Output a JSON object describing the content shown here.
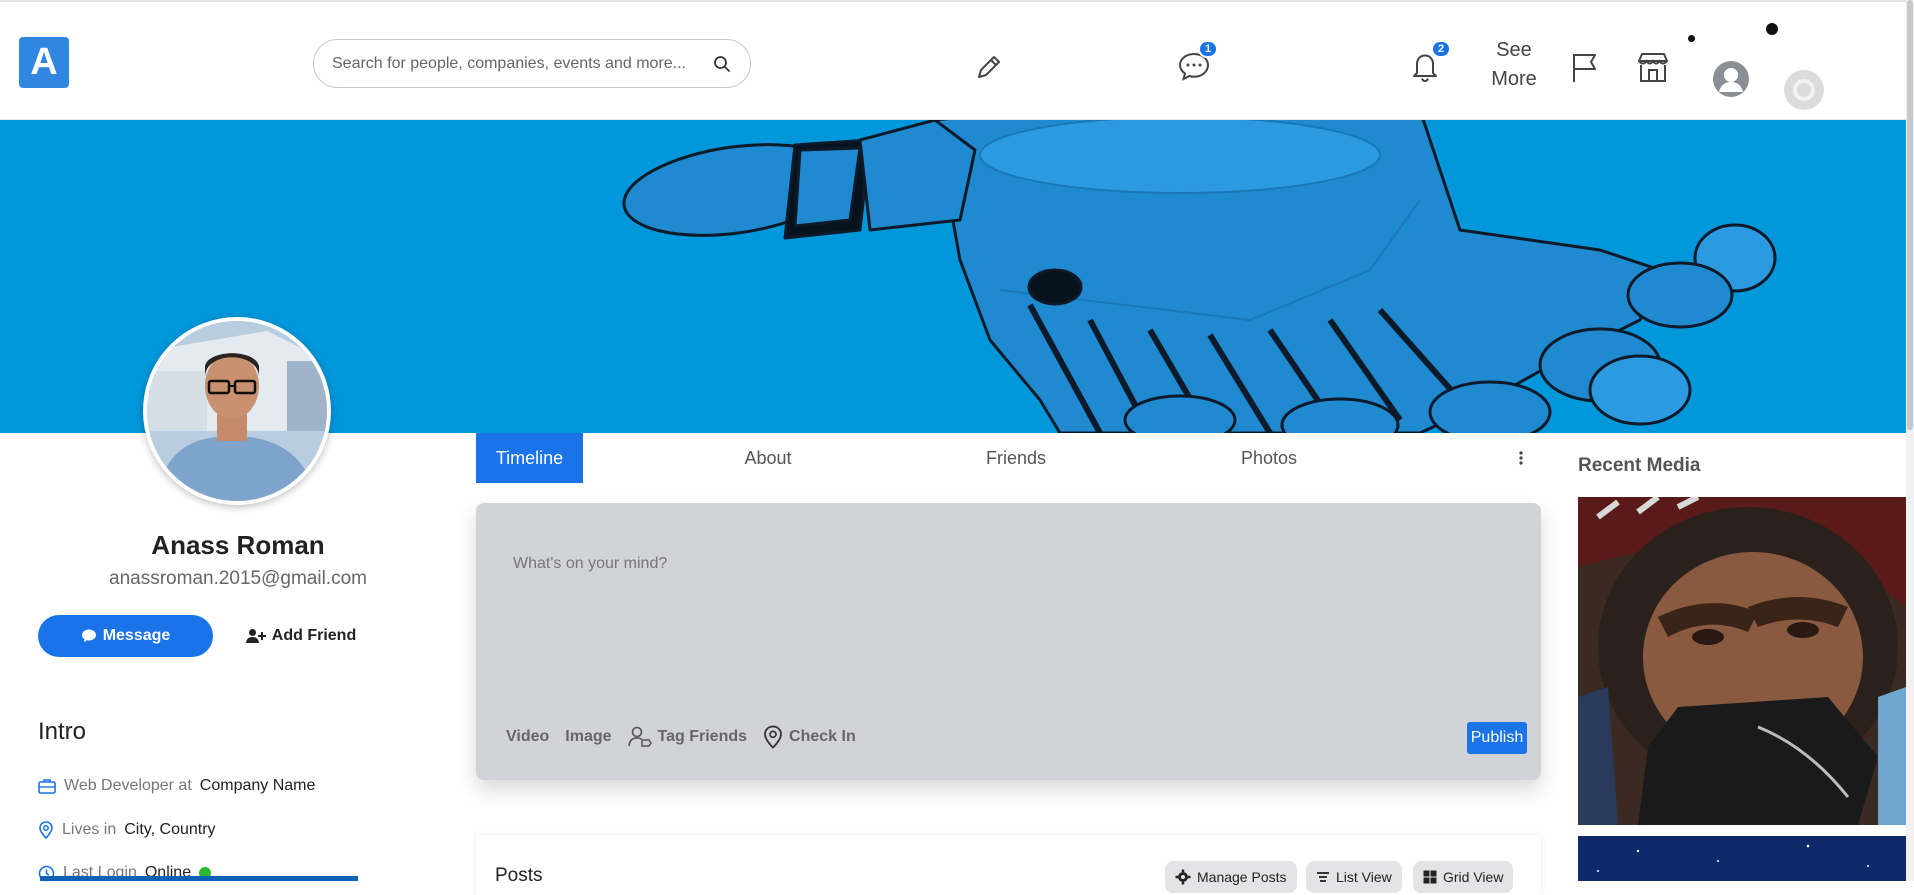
{
  "header": {
    "logo_letter": "A",
    "search_placeholder": "Search for people, companies, events and more...",
    "messages_badge": "1",
    "notifications_badge": "2",
    "see_more_line1": "See",
    "see_more_line2": "More"
  },
  "profile": {
    "name": "Anass Roman",
    "email": "anassroman.2015@gmail.com",
    "message_label": "Message",
    "add_friend_label": "Add Friend"
  },
  "intro": {
    "title": "Intro",
    "job_prefix": "Web Developer at",
    "job_company": "Company Name",
    "lives_prefix": "Lives in",
    "lives_place": "City, Country",
    "login_prefix": "Last Login",
    "login_status": "Online"
  },
  "tabs": {
    "timeline": "Timeline",
    "about": "About",
    "friends": "Friends",
    "photos": "Photos"
  },
  "composer": {
    "placeholder": "What's on your mind?",
    "video": "Video",
    "image": "Image",
    "tag_friends": "Tag Friends",
    "check_in": "Check In",
    "publish": "Publish"
  },
  "posts": {
    "title": "Posts",
    "manage": "Manage Posts",
    "list_view": "List View",
    "grid_view": "Grid View"
  },
  "sidebar": {
    "recent_media_title": "Recent Media"
  },
  "colors": {
    "accent": "#1a73e8",
    "cover": "#0097db",
    "composer_bg": "#d2d3d6",
    "online": "#2eb82e"
  }
}
